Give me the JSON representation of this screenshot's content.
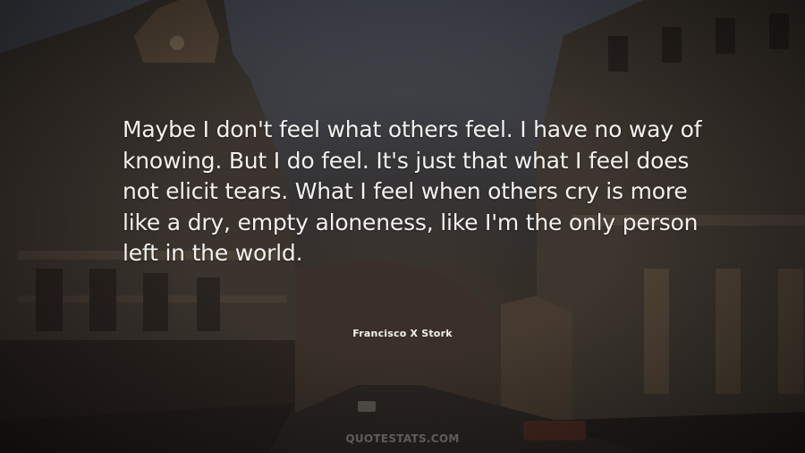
{
  "quote": {
    "text": "Maybe I don't feel what others feel. I have no way of knowing. But I do feel. It's just that what I feel does not elicit tears. What I feel when others cry is more like a dry, empty aloneness, like I'm the only person left in the world.",
    "author": "Francisco X Stork"
  },
  "watermark": {
    "text": "QUOTESTATS.COM"
  },
  "colors": {
    "text": "#f3f1ee",
    "overlay": "#1e1a18"
  }
}
